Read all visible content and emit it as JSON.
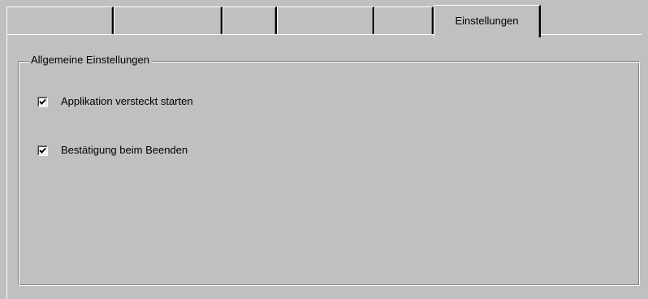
{
  "tabs": [
    {
      "label": ""
    },
    {
      "label": ""
    },
    {
      "label": ""
    },
    {
      "label": ""
    },
    {
      "label": ""
    },
    {
      "label": "Einstellungen"
    }
  ],
  "group": {
    "title": "Allgemeine Einstellungen",
    "options": [
      {
        "label": "Applikation versteckt starten",
        "checked": true
      },
      {
        "label": "Bestätigung beim Beenden",
        "checked": true
      }
    ]
  },
  "colors": {
    "face": "#c0c0c0",
    "highlight": "#ffffff",
    "shadow": "#808080",
    "dark_shadow": "#000000"
  },
  "icons": {
    "checkmark": "check-mark-icon"
  }
}
